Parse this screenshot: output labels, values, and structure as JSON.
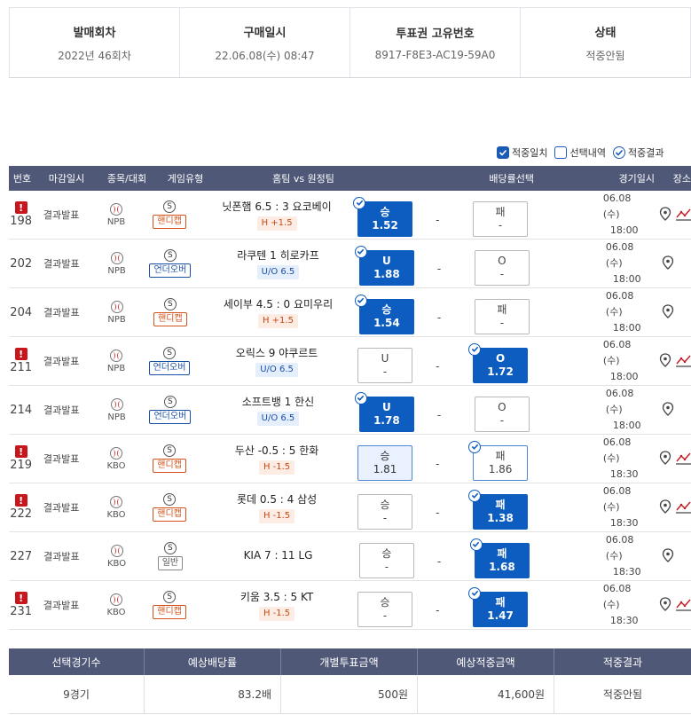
{
  "summary": [
    {
      "label": "발매회차",
      "value": "2022년 46회차"
    },
    {
      "label": "구매일시",
      "value": "22.06.08(수) 08:47"
    },
    {
      "label": "투표권 고유번호",
      "value": "8917-F8E3-AC19-59A0"
    },
    {
      "label": "상태",
      "value": "적중안됨"
    }
  ],
  "legend": [
    {
      "label": "적중일치",
      "style": "filled"
    },
    {
      "label": "선택내역",
      "style": "empty"
    },
    {
      "label": "적중결과",
      "style": "outline"
    }
  ],
  "headers": [
    "번호",
    "마감일시",
    "종목/대회",
    "게임유형",
    "홈팀 vs 원정팀",
    "배당률선택",
    "경기일시",
    "장소"
  ],
  "rows": [
    {
      "no": "198",
      "alert": true,
      "status": "결과발표",
      "league": "NPB",
      "type": "핸디캡",
      "type_kind": "hc",
      "teams": "닛폰햄 6.5 : 3 요코베이",
      "chip": "H +1.5",
      "chip_kind": "hc",
      "b1_label": "승",
      "b1_val": "1.52",
      "b1_state": "sel",
      "b1_check": true,
      "mid": "-",
      "b2_label": "패",
      "b2_val": "-",
      "b2_state": "",
      "b2_check": false,
      "date": "06.08 (수)",
      "time": "18:00",
      "trend": true
    },
    {
      "no": "202",
      "alert": false,
      "status": "결과발표",
      "league": "NPB",
      "type": "언더오버",
      "type_kind": "ou",
      "teams": "라쿠텐   1   히로카프",
      "chip": "U/O 6.5",
      "chip_kind": "ou",
      "b1_label": "U",
      "b1_val": "1.88",
      "b1_state": "sel",
      "b1_check": true,
      "mid": "-",
      "b2_label": "O",
      "b2_val": "-",
      "b2_state": "",
      "b2_check": false,
      "date": "06.08 (수)",
      "time": "18:00",
      "trend": false
    },
    {
      "no": "204",
      "alert": false,
      "status": "결과발표",
      "league": "NPB",
      "type": "핸디캡",
      "type_kind": "hc",
      "teams": "세이부 4.5 : 0 요미우리",
      "chip": "H +1.5",
      "chip_kind": "hc",
      "b1_label": "승",
      "b1_val": "1.54",
      "b1_state": "sel",
      "b1_check": true,
      "mid": "-",
      "b2_label": "패",
      "b2_val": "-",
      "b2_state": "",
      "b2_check": false,
      "date": "06.08 (수)",
      "time": "18:00",
      "trend": false
    },
    {
      "no": "211",
      "alert": true,
      "status": "결과발표",
      "league": "NPB",
      "type": "언더오버",
      "type_kind": "ou",
      "teams": "오릭스   9   야쿠르트",
      "chip": "U/O 6.5",
      "chip_kind": "ou",
      "b1_label": "U",
      "b1_val": "-",
      "b1_state": "",
      "b1_check": false,
      "mid": "-",
      "b2_label": "O",
      "b2_val": "1.72",
      "b2_state": "sel",
      "b2_check": true,
      "date": "06.08 (수)",
      "time": "18:00",
      "trend": true
    },
    {
      "no": "214",
      "alert": false,
      "status": "결과발표",
      "league": "NPB",
      "type": "언더오버",
      "type_kind": "ou",
      "teams": "소프트뱅   1   한신",
      "chip": "U/O 6.5",
      "chip_kind": "ou",
      "b1_label": "U",
      "b1_val": "1.78",
      "b1_state": "sel",
      "b1_check": true,
      "mid": "-",
      "b2_label": "O",
      "b2_val": "-",
      "b2_state": "",
      "b2_check": false,
      "date": "06.08 (수)",
      "time": "18:00",
      "trend": false
    },
    {
      "no": "219",
      "alert": true,
      "status": "결과발표",
      "league": "KBO",
      "type": "핸디캡",
      "type_kind": "hc",
      "teams": "두산 -0.5 : 5 한화",
      "chip": "H -1.5",
      "chip_kind": "hc",
      "b1_label": "승",
      "b1_val": "1.81",
      "b1_state": "light",
      "b1_check": false,
      "mid": "-",
      "b2_label": "패",
      "b2_val": "1.86",
      "b2_state": "outline",
      "b2_check": true,
      "date": "06.08 (수)",
      "time": "18:30",
      "trend": true
    },
    {
      "no": "222",
      "alert": true,
      "status": "결과발표",
      "league": "KBO",
      "type": "핸디캡",
      "type_kind": "hc",
      "teams": "롯데 0.5 : 4 삼성",
      "chip": "H -1.5",
      "chip_kind": "hc",
      "b1_label": "승",
      "b1_val": "-",
      "b1_state": "",
      "b1_check": false,
      "mid": "-",
      "b2_label": "패",
      "b2_val": "1.38",
      "b2_state": "sel",
      "b2_check": true,
      "date": "06.08 (수)",
      "time": "18:30",
      "trend": true
    },
    {
      "no": "227",
      "alert": false,
      "status": "결과발표",
      "league": "KBO",
      "type": "일반",
      "type_kind": "gen",
      "teams": "KIA 7 : 11 LG",
      "chip": "",
      "chip_kind": "",
      "b1_label": "승",
      "b1_val": "-",
      "b1_state": "",
      "b1_check": false,
      "mid": "-",
      "b2_label": "패",
      "b2_val": "1.68",
      "b2_state": "sel",
      "b2_check": true,
      "date": "06.08 (수)",
      "time": "18:30",
      "trend": false
    },
    {
      "no": "231",
      "alert": true,
      "status": "결과발표",
      "league": "KBO",
      "type": "핸디캡",
      "type_kind": "hc",
      "teams": "키움 3.5 : 5 KT",
      "chip": "H -1.5",
      "chip_kind": "hc",
      "b1_label": "승",
      "b1_val": "-",
      "b1_state": "",
      "b1_check": false,
      "mid": "-",
      "b2_label": "패",
      "b2_val": "1.47",
      "b2_state": "sel",
      "b2_check": true,
      "date": "06.08 (수)",
      "time": "18:30",
      "trend": true
    }
  ],
  "footer": {
    "headers": [
      "선택경기수",
      "예상배당률",
      "개별투표금액",
      "예상적중금액",
      "적중결과"
    ],
    "values": [
      "9경기",
      "83.2배",
      "500원",
      "41,600원",
      "적중안됨"
    ]
  },
  "colors": {
    "header_bg": "#4f5877",
    "selected": "#0d5cc0",
    "alert": "#c8161d",
    "handicap": "#d2541c",
    "underover": "#1a4fa8"
  },
  "icons": [
    "alert-icon",
    "baseball-icon",
    "s-icon",
    "check-icon",
    "location-pin-icon",
    "trend-chart-icon"
  ]
}
